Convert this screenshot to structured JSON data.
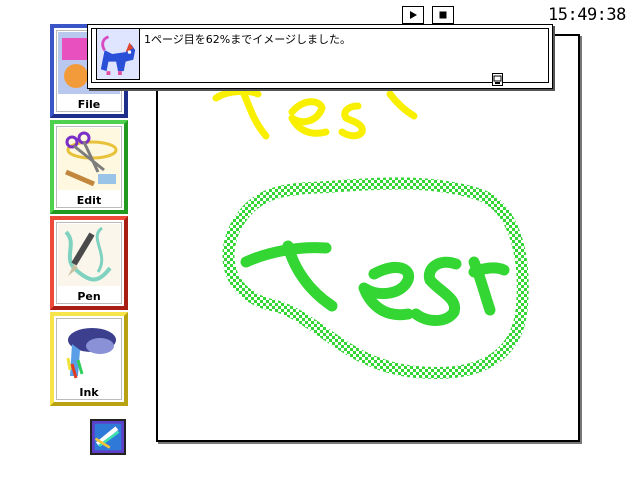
{
  "clock": {
    "time": "15:49:38"
  },
  "controls": {
    "play_icon": "play-icon",
    "stop_icon": "stop-icon"
  },
  "palette": {
    "tiles": [
      {
        "label": "File",
        "color": "#2a44b8",
        "icon": "file-folder-icon"
      },
      {
        "label": "Edit",
        "color": "#33c033",
        "icon": "scissors-icon"
      },
      {
        "label": "Pen",
        "color": "#e03324",
        "icon": "fountain-pen-icon"
      },
      {
        "label": "Ink",
        "color": "#f0d830",
        "icon": "ink-blot-icon"
      }
    ]
  },
  "dialog": {
    "message": "1ページ目を62%までイメージしました。",
    "icon": "cat-icon",
    "grip_icon": "resize-grip-icon"
  },
  "canvas": {
    "handwriting_yellow": "Test",
    "handwriting_green": "Test",
    "ink_colors": {
      "yellow": "#f8f000",
      "green": "#33d633"
    }
  },
  "bottom_icon": "pen-tool-icon"
}
